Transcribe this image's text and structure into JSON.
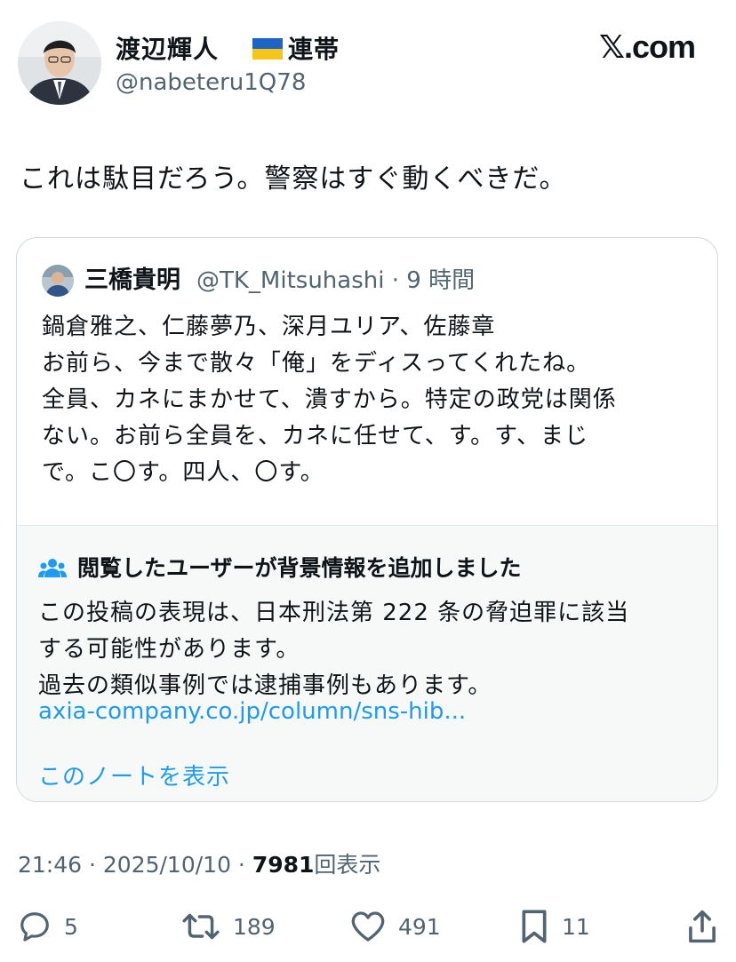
{
  "author": {
    "display_name": "渡辺輝人",
    "display_suffix": "連帯",
    "handle": "@nabeteru1Q78",
    "flag": "ukraine-flag"
  },
  "site": {
    "logo": "𝕏.com"
  },
  "post": {
    "text": "これは駄目だろう。警察はすぐ動くべきだ。"
  },
  "quote": {
    "name": "三橋貴明",
    "handle_time": "@TK_Mitsuhashi · 9 時間",
    "lines": [
      "鍋倉雅之、仁藤夢乃、深月ユリア、佐藤章",
      "お前ら、今まで散々「俺」をディスってくれたね。",
      "全員、カネにまかせて、潰すから。特定の政党は関係",
      "ない。お前ら全員を、カネに任せて、す。す、まじ",
      "で。こ〇す。四人、〇す。"
    ]
  },
  "community_note": {
    "title": "閲覧したユーザーが背景情報を追加しました",
    "body": [
      "この投稿の表現は、日本刑法第 222 条の脅迫罪に該当",
      "する可能性があります。",
      "過去の類似事例では逮捕事例もあります。"
    ],
    "link": "axia-company.co.jp/column/sns-hib...",
    "show_note": "このノートを表示"
  },
  "meta": {
    "time_date": "21:46 · 2025/10/10 · ",
    "views": "7981",
    "views_label": "回表示"
  },
  "actions": {
    "replies": "5",
    "reposts": "189",
    "likes": "491",
    "bookmarks": "11"
  },
  "colors": {
    "link": "#1d9bf0",
    "muted": "#536471",
    "text": "#0f1419",
    "border": "#cfd9de",
    "note_bg": "#f7f9f9"
  }
}
